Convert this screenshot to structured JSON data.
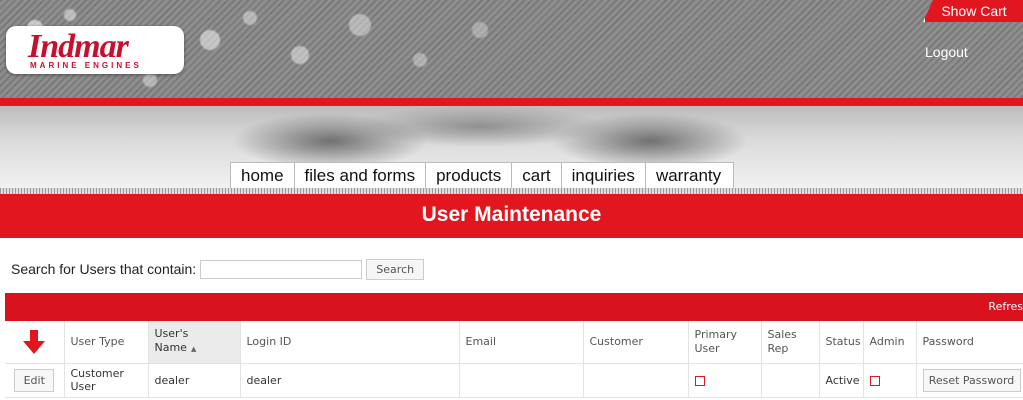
{
  "header": {
    "brand": "Indmar",
    "brand_sub": "MARINE ENGINES",
    "show_cart": "Show Cart",
    "logout": "Logout"
  },
  "nav": {
    "items": [
      {
        "label": "home"
      },
      {
        "label": "files and forms"
      },
      {
        "label": "products"
      },
      {
        "label": "cart"
      },
      {
        "label": "inquiries"
      },
      {
        "label": "warranty"
      }
    ]
  },
  "page": {
    "title": "User Maintenance"
  },
  "search": {
    "label": "Search for Users that contain:",
    "value": "",
    "button": "Search"
  },
  "grid": {
    "refresh": "Refres",
    "columns": {
      "user_type": "User Type",
      "users_name": "User's Name",
      "login_id": "Login ID",
      "email": "Email",
      "customer": "Customer",
      "primary_user": "Primary User",
      "sales_rep": "Sales Rep",
      "status": "Status",
      "admin": "Admin",
      "password": "Password"
    },
    "rows": [
      {
        "edit": "Edit",
        "user_type": "Customer User",
        "users_name": "dealer",
        "login_id": "dealer",
        "email": "",
        "customer": "",
        "primary_user": "",
        "sales_rep": "",
        "status": "Active",
        "admin": "",
        "password": "Reset Password"
      }
    ]
  },
  "colors": {
    "brand_red": "#e2161f",
    "grid_bar_red": "#d9131d"
  }
}
